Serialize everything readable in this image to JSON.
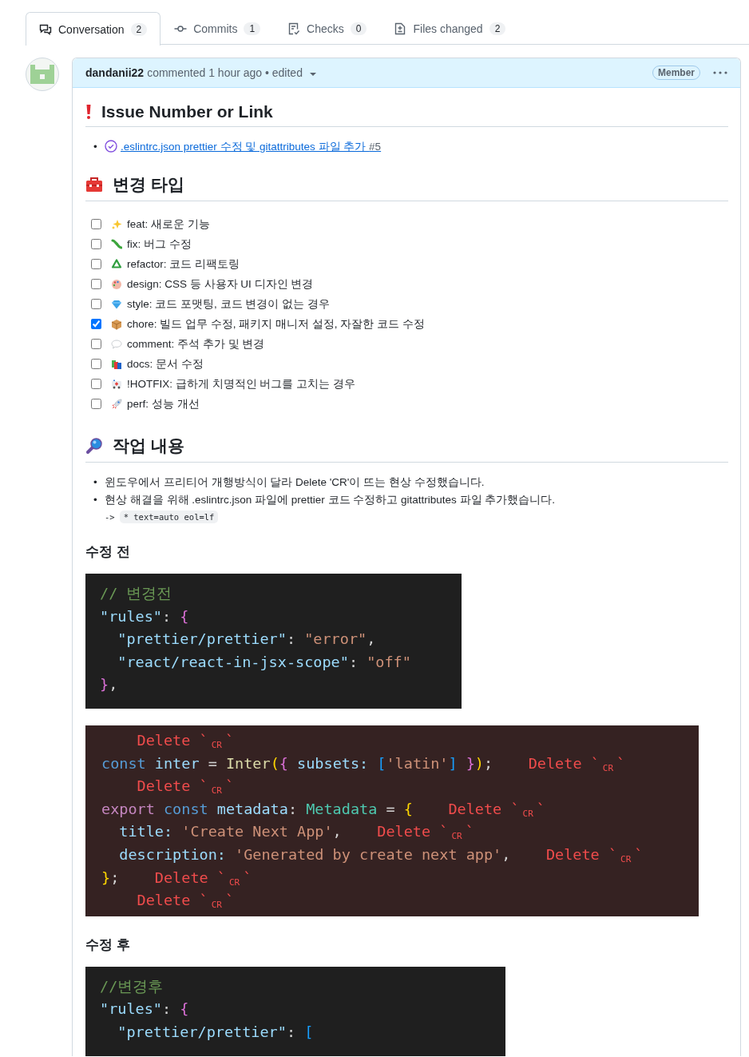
{
  "tabs": [
    {
      "kind": "conversation",
      "label": "Conversation",
      "count": "2",
      "selected": true
    },
    {
      "kind": "commits",
      "label": "Commits",
      "count": "1",
      "selected": false
    },
    {
      "kind": "checks",
      "label": "Checks",
      "count": "0",
      "selected": false
    },
    {
      "kind": "files",
      "label": "Files changed",
      "count": "2",
      "selected": false
    }
  ],
  "comment": {
    "author": "dandanii22",
    "meta": "commented 1 hour ago • edited",
    "role": "Member",
    "issue_section": {
      "heading": "Issue Number or Link",
      "marker": "•",
      "link": ".eslintrc.json prettier 수정 및 gitattributes 파일 추가",
      "number": "#5"
    },
    "change_section": {
      "heading": "변경 타입",
      "items": [
        {
          "kind": "sparkles",
          "label": "feat: 새로운 기능",
          "checked": false
        },
        {
          "kind": "caterpillar",
          "label": "fix: 버그 수정",
          "checked": false
        },
        {
          "kind": "recycle",
          "label": "refactor: 코드 리팩토링",
          "checked": false
        },
        {
          "kind": "palette",
          "label": "design: CSS 등 사용자 UI 디자인 변경",
          "checked": false
        },
        {
          "kind": "diamond",
          "label": "style: 코드 포맷팅, 코드 변경이 없는 경우",
          "checked": false
        },
        {
          "kind": "box",
          "label": "chore: 빌드 업무 수정, 패키지 매니저 설정, 자잘한 코드 수정",
          "checked": true
        },
        {
          "kind": "bubble",
          "label": "comment: 주석 추가 및 변경",
          "checked": false
        },
        {
          "kind": "books",
          "label": "docs: 문서 수정",
          "checked": false
        },
        {
          "kind": "ambulance",
          "label": "!HOTFIX: 급하게 치명적인 버그를 고치는 경우",
          "checked": false
        },
        {
          "kind": "rocket",
          "label": "perf: 성능 개선",
          "checked": false
        }
      ]
    },
    "work_section": {
      "heading": "작업 내용",
      "bullets": [
        {
          "marker": "•",
          "text": "윈도우에서 프리티어 개행방식이 달라 Delete 'CR'이 뜨는 현상 수정했습니다."
        },
        {
          "marker": "•",
          "text": "현상 해결을 위해 .eslintrc.json 파일에 prettier 코드 수정하고 gitattributes 파일 추가했습니다.",
          "arrow": "->",
          "code": "* text=auto eol=lf"
        }
      ]
    },
    "before": {
      "heading": "수정 전",
      "screenshots": [
        {
          "kind": "dark",
          "lines": [
            [
              {
                "t": "// 변경전",
                "color": "#6a9955"
              }
            ],
            [
              {
                "t": "\"rules\"",
                "color": "#9cdcfe"
              },
              {
                "t": ": ",
                "color": "#d4d4d4"
              },
              {
                "t": "{",
                "color": "#da70d6"
              }
            ],
            [
              {
                "t": "  \"prettier/prettier\"",
                "color": "#9cdcfe"
              },
              {
                "t": ": ",
                "color": "#d4d4d4"
              },
              {
                "t": "\"error\"",
                "color": "#ce9178"
              },
              {
                "t": ",",
                "color": "#d4d4d4"
              }
            ],
            [
              {
                "t": "  \"react/react-in-jsx-scope\"",
                "color": "#9cdcfe"
              },
              {
                "t": ": ",
                "color": "#d4d4d4"
              },
              {
                "t": "\"off\"",
                "color": "#ce9178"
              }
            ],
            [
              {
                "t": "}",
                "color": "#da70d6"
              },
              {
                "t": ",",
                "color": "#d4d4d4"
              }
            ]
          ]
        },
        {
          "kind": "lint",
          "lines": [
            [
              {
                "t": "    Delete `",
                "cr": "CR",
                "close": "`",
                "color": "#f14c4c"
              }
            ],
            [
              {
                "t": "const ",
                "color": "#569cd6"
              },
              {
                "t": "inter",
                "color": "#9cdcfe"
              },
              {
                "t": " = ",
                "color": "#d4d4d4"
              },
              {
                "t": "Inter",
                "color": "#dcdcaa"
              },
              {
                "t": "(",
                "color": "#ffd700"
              },
              {
                "t": "{",
                "color": "#da70d6"
              },
              {
                "t": " subsets: ",
                "color": "#9cdcfe"
              },
              {
                "t": "[",
                "color": "#179fff"
              },
              {
                "t": "'latin'",
                "color": "#ce9178"
              },
              {
                "t": "]",
                "color": "#179fff"
              },
              {
                "t": " }",
                "color": "#da70d6"
              },
              {
                "t": ")",
                "color": "#ffd700"
              },
              {
                "t": ";",
                "color": "#d4d4d4"
              },
              {
                "t": "    Delete `",
                "cr": "CR",
                "close": "`",
                "color": "#f14c4c"
              }
            ],
            [
              {
                "t": "    Delete `",
                "cr": "CR",
                "close": "`",
                "color": "#f14c4c"
              }
            ],
            [
              {
                "t": "export ",
                "color": "#c586c0"
              },
              {
                "t": "const ",
                "color": "#569cd6"
              },
              {
                "t": "metadata",
                "color": "#9cdcfe"
              },
              {
                "t": ": ",
                "color": "#d4d4d4"
              },
              {
                "t": "Metadata",
                "color": "#4ec9b0"
              },
              {
                "t": " = ",
                "color": "#d4d4d4"
              },
              {
                "t": "{",
                "color": "#ffd700"
              },
              {
                "t": "    Delete `",
                "cr": "CR",
                "close": "`",
                "color": "#f14c4c"
              }
            ],
            [
              {
                "t": "  title: ",
                "color": "#9cdcfe"
              },
              {
                "t": "'Create Next App'",
                "color": "#ce9178"
              },
              {
                "t": ",",
                "color": "#d4d4d4"
              },
              {
                "t": "    Delete `",
                "cr": "CR",
                "close": "`",
                "color": "#f14c4c"
              }
            ],
            [
              {
                "t": "  description: ",
                "color": "#9cdcfe"
              },
              {
                "t": "'Generated by create next app'",
                "color": "#ce9178"
              },
              {
                "t": ",",
                "color": "#d4d4d4"
              },
              {
                "t": "    Delete `",
                "cr": "CR",
                "close": "`",
                "color": "#f14c4c"
              }
            ],
            [
              {
                "t": "}",
                "color": "#ffd700"
              },
              {
                "t": ";",
                "color": "#d4d4d4"
              },
              {
                "t": "    Delete `",
                "cr": "CR",
                "close": "`",
                "color": "#f14c4c"
              }
            ],
            [
              {
                "t": "    Delete `",
                "cr": "CR",
                "close": "`",
                "color": "#f14c4c"
              }
            ]
          ]
        }
      ]
    },
    "after": {
      "heading": "수정 후",
      "screenshots": [
        {
          "kind": "dark",
          "lines": [
            [
              {
                "t": "//변경후",
                "color": "#6a9955"
              }
            ],
            [
              {
                "t": "\"rules\"",
                "color": "#9cdcfe"
              },
              {
                "t": ": ",
                "color": "#d4d4d4"
              },
              {
                "t": "{",
                "color": "#da70d6"
              }
            ],
            [
              {
                "t": "  \"prettier/prettier\"",
                "color": "#9cdcfe"
              },
              {
                "t": ": ",
                "color": "#d4d4d4"
              },
              {
                "t": "[",
                "color": "#179fff"
              }
            ]
          ]
        }
      ]
    }
  }
}
